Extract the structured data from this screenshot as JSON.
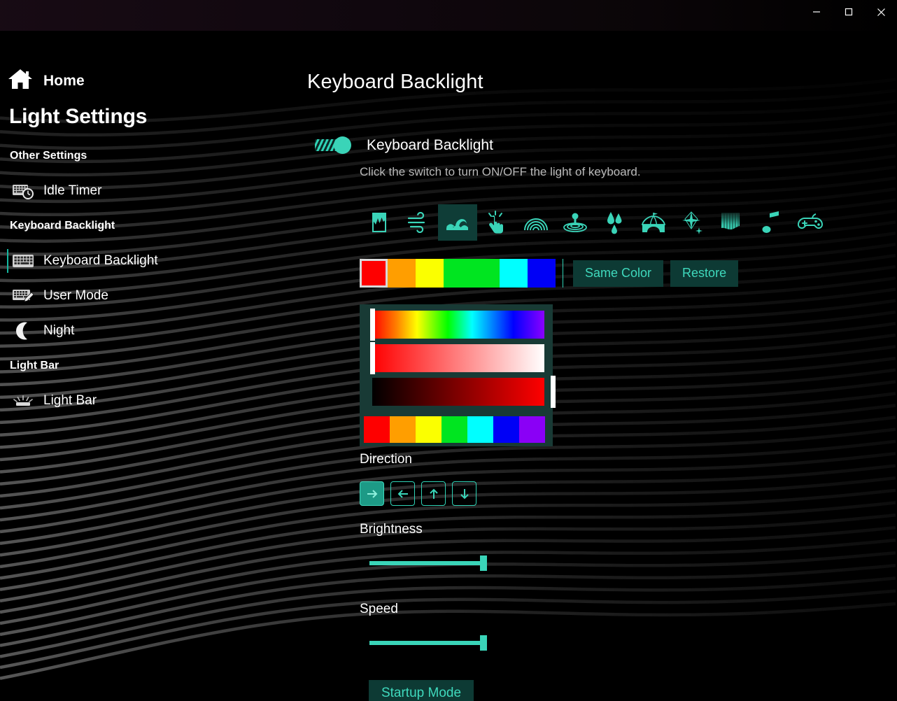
{
  "window": {
    "controls": [
      {
        "name": "minimize",
        "label": "Minimize"
      },
      {
        "name": "maximize",
        "label": "Maximize"
      },
      {
        "name": "close",
        "label": "Close"
      }
    ]
  },
  "sidebar": {
    "home_label": "Home",
    "app_title": "Light Settings",
    "groups": [
      {
        "heading": "Other Settings",
        "items": [
          {
            "label": "Idle Timer",
            "icon": "idle-timer-icon",
            "active": false
          }
        ]
      },
      {
        "heading": "Keyboard Backlight",
        "items": [
          {
            "label": "Keyboard Backlight",
            "icon": "keyboard-icon",
            "active": true
          },
          {
            "label": "User Mode",
            "icon": "keyboard-edit-icon",
            "active": false
          },
          {
            "label": "Night",
            "icon": "moon-icon",
            "active": false
          }
        ]
      },
      {
        "heading": "Light Bar",
        "items": [
          {
            "label": "Light Bar",
            "icon": "light-bar-icon",
            "active": false
          }
        ]
      }
    ]
  },
  "main": {
    "page_title": "Keyboard Backlight",
    "toggle": {
      "label": "Keyboard Backlight",
      "state": "on"
    },
    "helper_text": "Click the switch to turn ON/OFF the light of keyboard.",
    "effects": [
      {
        "name": "paint-drip-icon",
        "selected": false
      },
      {
        "name": "wind-icon",
        "selected": false
      },
      {
        "name": "wave-icon",
        "selected": true
      },
      {
        "name": "touch-icon",
        "selected": false
      },
      {
        "name": "rainbow-icon",
        "selected": false
      },
      {
        "name": "ripple-icon",
        "selected": false
      },
      {
        "name": "raindrops-icon",
        "selected": false
      },
      {
        "name": "circus-tent-icon",
        "selected": false
      },
      {
        "name": "sparkle-icon",
        "selected": false
      },
      {
        "name": "waterfall-icon",
        "selected": false
      },
      {
        "name": "music-note-icon",
        "selected": false
      },
      {
        "name": "gamepad-icon",
        "selected": false
      }
    ],
    "swatches": [
      {
        "color": "#fe0000",
        "selected": true
      },
      {
        "color": "#ff9e00",
        "selected": false
      },
      {
        "color": "#fbff00",
        "selected": false
      },
      {
        "color": "#00e520",
        "selected": false
      },
      {
        "color": "#00e520",
        "selected": false
      },
      {
        "color": "#00ffff",
        "selected": false
      },
      {
        "color": "#0000f6",
        "selected": false
      }
    ],
    "same_color_label": "Same Color",
    "restore_label": "Restore",
    "picker": {
      "hue_thumb_pct": 0,
      "sat_thumb_pct": 0,
      "val_thumb_pct": 100,
      "presets": [
        "#fe0000",
        "#ff9e00",
        "#fbff00",
        "#00e520",
        "#00ffff",
        "#0000f6",
        "#8a00f6"
      ]
    },
    "direction": {
      "label": "Direction",
      "buttons": [
        {
          "name": "direction-right",
          "glyph": "→",
          "selected": true
        },
        {
          "name": "direction-left",
          "glyph": "←",
          "selected": false
        },
        {
          "name": "direction-up",
          "glyph": "↑",
          "selected": false
        },
        {
          "name": "direction-down",
          "glyph": "↓",
          "selected": false
        }
      ]
    },
    "brightness": {
      "label": "Brightness",
      "value_pct": 64
    },
    "speed": {
      "label": "Speed",
      "value_pct": 64
    },
    "startup_mode_label": "Startup Mode"
  },
  "colors": {
    "accent": "#3ad4b8",
    "accent_dark": "#0d3a34",
    "panel": "#183a35",
    "text": "#ffffff",
    "muted": "#b9b9b9"
  }
}
